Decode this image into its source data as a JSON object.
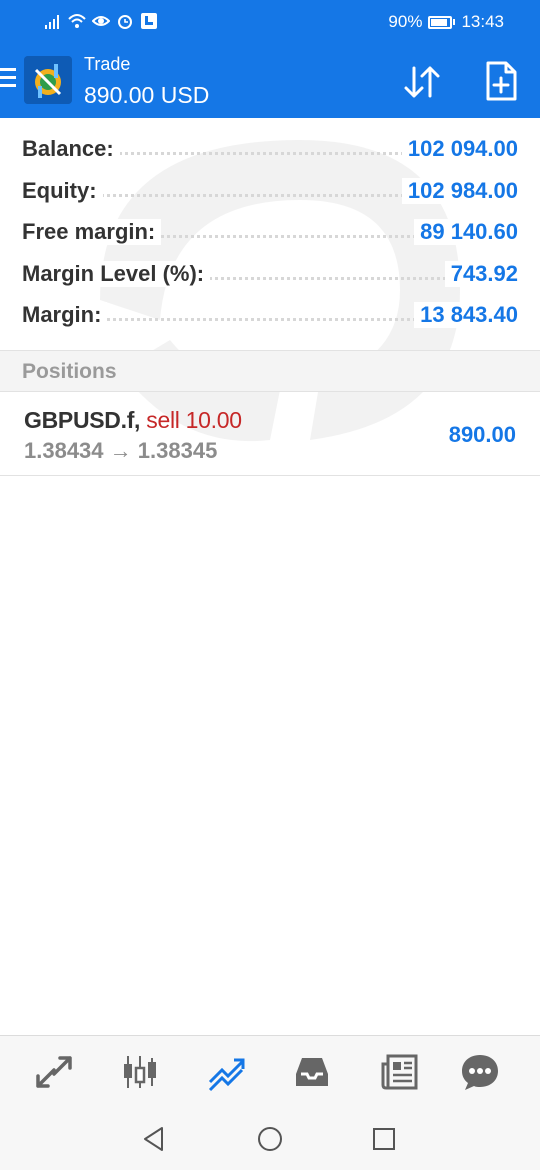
{
  "status_bar": {
    "battery_percent": "90%",
    "battery_level": 0.9,
    "time": "13:43",
    "icons": [
      "signal-icon",
      "wifi-icon",
      "eye-icon",
      "alarm-icon",
      "app-notification-icon"
    ]
  },
  "app_bar": {
    "title": "Trade",
    "subtitle": "890.00 USD",
    "icons": [
      "menu-icon",
      "app-logo",
      "sort-icon",
      "new-order-icon"
    ]
  },
  "summary": {
    "rows": [
      {
        "label": "Balance:",
        "value": "102 094.00"
      },
      {
        "label": "Equity:",
        "value": "102 984.00"
      },
      {
        "label": "Free margin:",
        "value": "89 140.60"
      },
      {
        "label": "Margin Level (%):",
        "value": "743.92"
      },
      {
        "label": "Margin:",
        "value": "13 843.40"
      }
    ]
  },
  "positions": {
    "header": "Positions",
    "items": [
      {
        "symbol": "GBPUSD.f,",
        "side": "sell 10.00",
        "price_open": "1.38434",
        "arrow": "→",
        "price_current": "1.38345",
        "profit": "890.00"
      }
    ]
  },
  "tab_bar": {
    "tabs": [
      "quotes-icon",
      "chart-icon",
      "trade-icon",
      "history-icon",
      "news-icon",
      "chat-icon"
    ],
    "active": "trade-icon"
  },
  "nav_bar": {
    "buttons": [
      "back-icon",
      "home-icon",
      "recents-icon"
    ]
  },
  "colors": {
    "primary": "#1577e6",
    "sell": "#c62828",
    "label": "#333333",
    "muted": "#8c8c8c"
  }
}
